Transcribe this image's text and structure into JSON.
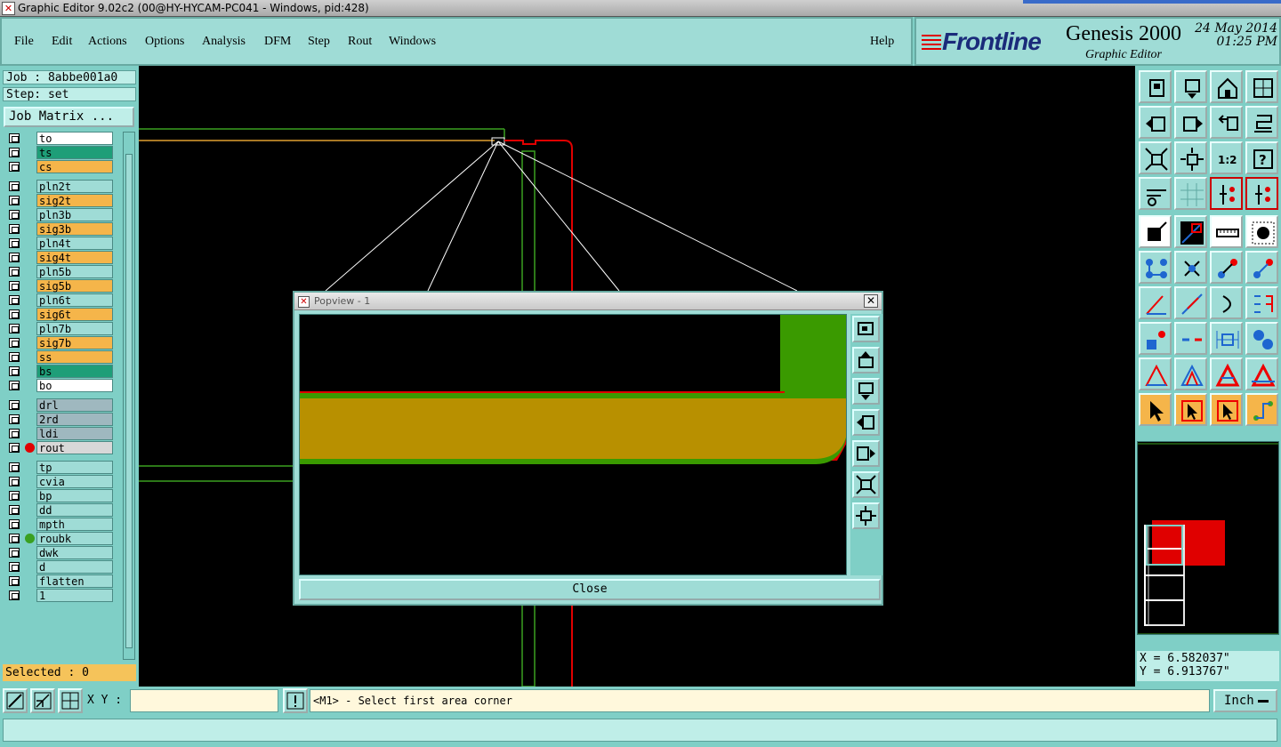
{
  "window": {
    "title": "Graphic Editor 9.02c2 (00@HY-HYCAM-PC041 - Windows, pid:428)"
  },
  "menu": {
    "file": "File",
    "edit": "Edit",
    "actions": "Actions",
    "options": "Options",
    "analysis": "Analysis",
    "dfm": "DFM",
    "step": "Step",
    "rout": "Rout",
    "windows": "Windows",
    "help": "Help"
  },
  "brand": {
    "logo": "Frontline",
    "product": "Genesis 2000",
    "subtitle": "Graphic Editor",
    "date": "24 May 2014",
    "time": "01:25 PM"
  },
  "job": {
    "job_line": "Job : 8abbe001a0",
    "step_line": "Step: set",
    "matrix_button": "Job Matrix ..."
  },
  "layers": [
    {
      "name": "to",
      "color": "#ffffff"
    },
    {
      "name": "ts",
      "color": "#1e9e78"
    },
    {
      "name": "cs",
      "color": "#f5b54a"
    },
    {
      "name": "pln2t",
      "color": "#9fdcd6"
    },
    {
      "name": "sig2t",
      "color": "#f5b54a"
    },
    {
      "name": "pln3b",
      "color": "#9fdcd6"
    },
    {
      "name": "sig3b",
      "color": "#f5b54a"
    },
    {
      "name": "pln4t",
      "color": "#9fdcd6"
    },
    {
      "name": "sig4t",
      "color": "#f5b54a"
    },
    {
      "name": "pln5b",
      "color": "#9fdcd6"
    },
    {
      "name": "sig5b",
      "color": "#f5b54a"
    },
    {
      "name": "pln6t",
      "color": "#9fdcd6"
    },
    {
      "name": "sig6t",
      "color": "#f5b54a"
    },
    {
      "name": "pln7b",
      "color": "#9fdcd6"
    },
    {
      "name": "sig7b",
      "color": "#f5b54a"
    },
    {
      "name": "ss",
      "color": "#f5b54a"
    },
    {
      "name": "bs",
      "color": "#1e9e78"
    },
    {
      "name": "bo",
      "color": "#ffffff"
    },
    {
      "name": "drl",
      "color": "#9fb8bf"
    },
    {
      "name": "2rd",
      "color": "#9fb8bf"
    },
    {
      "name": "ldi",
      "color": "#9fb8bf"
    },
    {
      "name": "rout",
      "color": "#d8d8d8",
      "dot": "#e00000"
    },
    {
      "name": "tp",
      "color": "#9fdcd6"
    },
    {
      "name": "cvia",
      "color": "#9fdcd6"
    },
    {
      "name": "bp",
      "color": "#9fdcd6"
    },
    {
      "name": "dd",
      "color": "#9fdcd6"
    },
    {
      "name": "mpth",
      "color": "#9fdcd6"
    },
    {
      "name": "roubk",
      "color": "#9fdcd6",
      "dot": "#3aa020"
    },
    {
      "name": "dwk",
      "color": "#9fdcd6"
    },
    {
      "name": "d",
      "color": "#9fdcd6"
    },
    {
      "name": "flatten",
      "color": "#9fdcd6"
    },
    {
      "name": "1",
      "color": "#9fdcd6"
    }
  ],
  "selected": "Selected : 0",
  "popview": {
    "title": "Popview - 1",
    "close_label": "Close"
  },
  "coords": {
    "x": "X = 6.582037\"",
    "y": "Y = 6.913767\""
  },
  "bottom": {
    "xy_label": "X Y :",
    "xy_value": "",
    "prompt": "<M1> - Select first area corner",
    "unit": "Inch"
  },
  "colors": {
    "panel": "#7fcfc6",
    "canvas": "#000000",
    "signal": "#f5b54a",
    "rout": "#e00000",
    "green": "#3aa020"
  }
}
